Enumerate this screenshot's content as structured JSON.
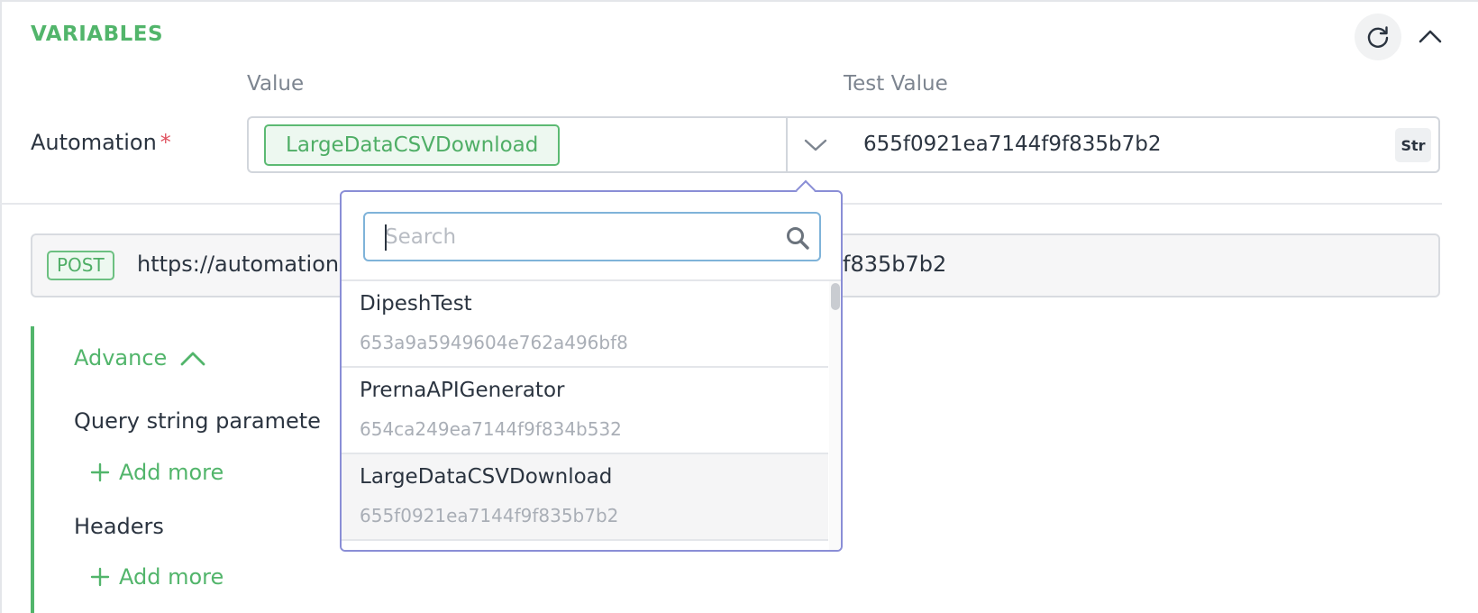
{
  "section": {
    "title": "VARIABLES"
  },
  "columns": {
    "value": "Value",
    "test_value": "Test Value"
  },
  "variable": {
    "label": "Automation",
    "required_mark": "*",
    "selected_chip": "LargeDataCSVDownload",
    "test_value": "655f0921ea7144f9f835b7b2",
    "type_badge": "Str"
  },
  "request": {
    "method": "POST",
    "url_visible_start": "https://automation",
    "url_visible_end": "f835b7b2"
  },
  "advance": {
    "label": "Advance",
    "query_title": "Query string paramete",
    "add_more_label": "Add more",
    "headers_title": "Headers"
  },
  "dropdown": {
    "search_placeholder": "Search",
    "items": [
      {
        "name": "DipeshTest",
        "id": "653a9a5949604e762a496bf8"
      },
      {
        "name": "PrernaAPIGenerator",
        "id": "654ca249ea7144f9f834b532"
      },
      {
        "name": "LargeDataCSVDownload",
        "id": "655f0921ea7144f9f835b7b2"
      }
    ],
    "selected_index": 2
  },
  "icons": {
    "refresh": "refresh-icon",
    "collapse": "chevron-up-icon",
    "dropdown": "chevron-down-icon",
    "search": "search-icon",
    "add": "plus-icon"
  },
  "colors": {
    "accent_green": "#52b56b",
    "required_red": "#e05260",
    "dropdown_border": "#8a8ed6",
    "search_border": "#7fb3d9"
  }
}
